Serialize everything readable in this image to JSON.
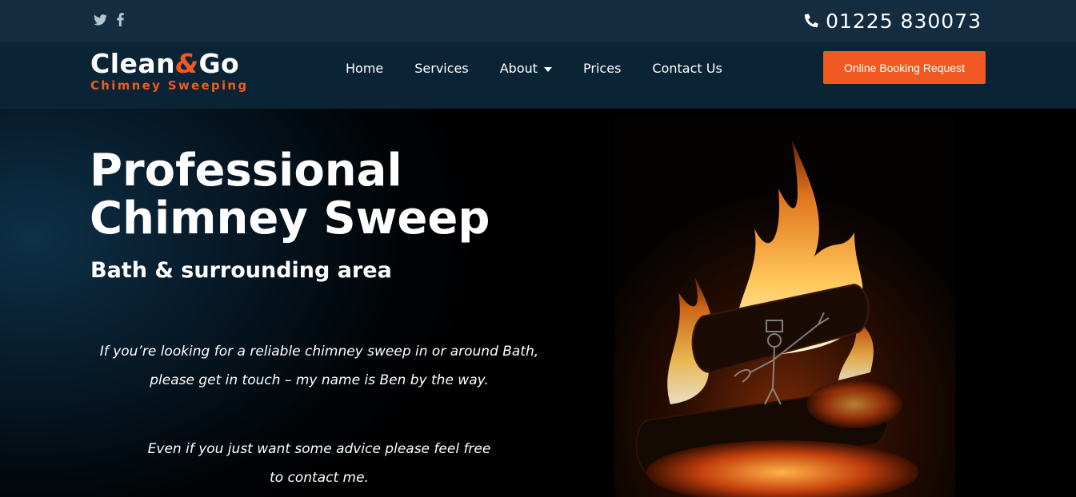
{
  "topbar": {
    "social_icons": [
      "twitter-icon",
      "facebook-icon"
    ],
    "phone_icon": "phone-icon",
    "phone": "01225 830073"
  },
  "logo": {
    "main_part1": "Clean",
    "ampersand": "&",
    "main_part2": "Go",
    "sub": "Chimney Sweeping"
  },
  "nav": {
    "items": [
      "Home",
      "Services",
      "About",
      "Prices",
      "Contact Us"
    ]
  },
  "booking_button": "Online Booking Request",
  "hero": {
    "title_line1": "Professional",
    "title_line2": "Chimney Sweep",
    "subtitle": "Bath & surrounding area",
    "para1_line1": "If you’re looking for a reliable chimney sweep in or around Bath,",
    "para1_line2": "please get in touch – my name is Ben by the way.",
    "para2_line1": "Even if you just want some advice please feel free",
    "para2_line2": "to contact me."
  },
  "colors": {
    "accent": "#f05a22",
    "topbar": "#132c3f",
    "navbar": "#0b2435"
  }
}
